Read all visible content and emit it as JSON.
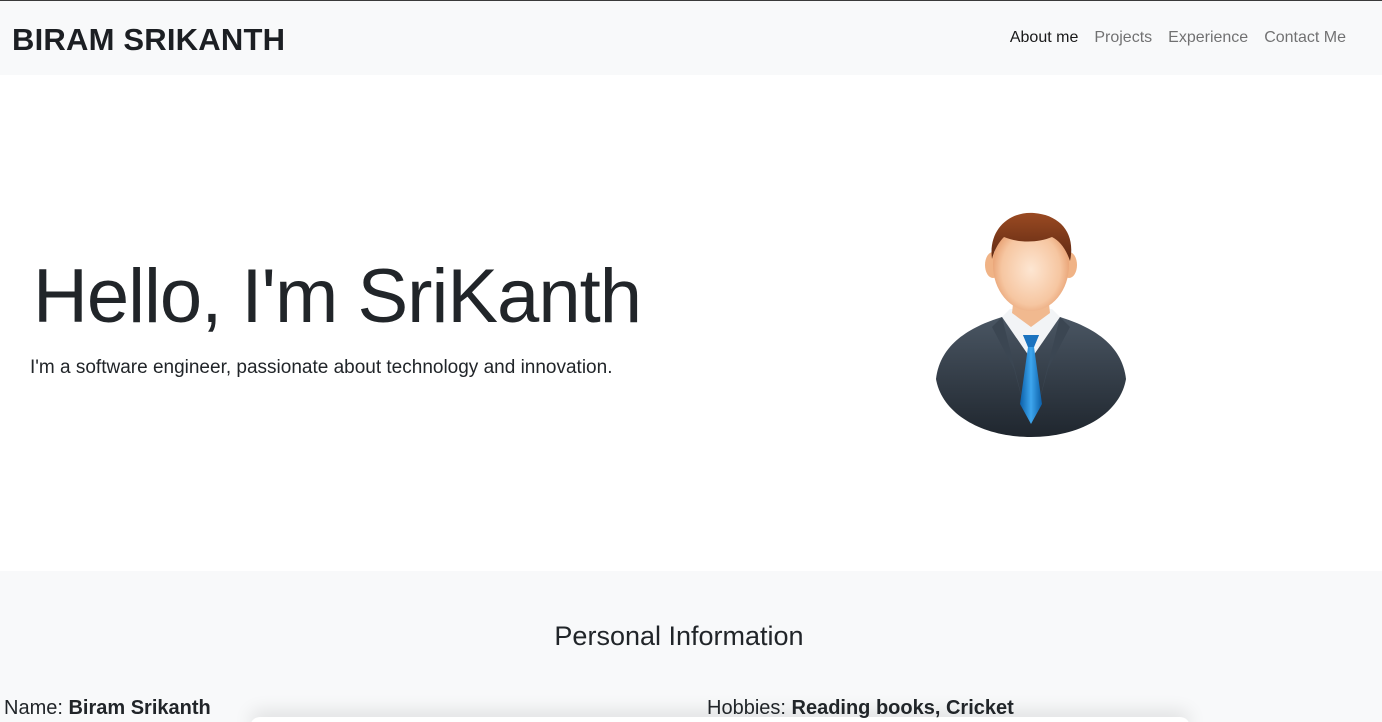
{
  "navbar": {
    "brand": "BIRAM SRIKANTH",
    "links": [
      {
        "label": "About me",
        "active": true
      },
      {
        "label": "Projects",
        "active": false
      },
      {
        "label": "Experience",
        "active": false
      },
      {
        "label": "Contact Me",
        "active": false
      }
    ]
  },
  "hero": {
    "title": "Hello, I'm SriKanth",
    "subtitle": "I'm a software engineer, passionate about technology and innovation.",
    "avatar_icon": "businessman-avatar-icon"
  },
  "personal_info": {
    "heading": "Personal Information",
    "name_label": "Name:",
    "name_value": "Biram Srikanth",
    "hobbies_label": "Hobbies:",
    "hobbies_value": "Reading books, Cricket"
  },
  "colors": {
    "navbar_bg": "#f8f9fa",
    "text": "#212529",
    "tie_blue": "#1e88d6",
    "suit": "#2f3a46",
    "hair": "#7a3a1c"
  }
}
